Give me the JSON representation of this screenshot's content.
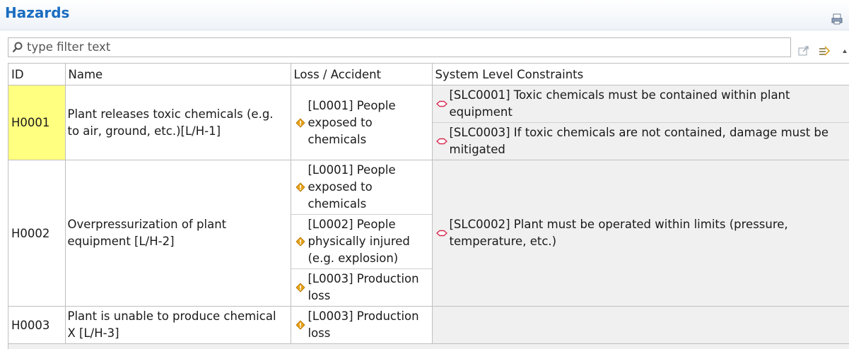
{
  "view": {
    "title": "Hazards"
  },
  "filter": {
    "placeholder": "type filter text"
  },
  "table": {
    "headers": {
      "id": "ID",
      "name": "Name",
      "loss": "Loss / Accident",
      "constraints": "System Level Constraints"
    },
    "rows": [
      {
        "id": "H0001",
        "name": "Plant releases toxic chemicals (e.g. to air, ground, etc.)[L/H-1]",
        "losses": [
          "[L0001] People exposed to chemicals"
        ],
        "constraints": [
          "[SLC0001] Toxic chemicals must be contained within plant equipment",
          "[SLC0003] If toxic chemicals are not contained, damage must be mitigated"
        ]
      },
      {
        "id": "H0002",
        "name": "Overpressurization of plant equipment [L/H-2]",
        "losses": [
          "[L0001] People exposed to chemicals",
          "[L0002] People physically injured (e.g. explosion)",
          "[L0003] Production loss"
        ],
        "constraints": [
          "[SLC0002] Plant must be operated within limits (pressure, temperature, etc.)"
        ]
      },
      {
        "id": "H0003",
        "name": "Plant is unable to produce chemical X [L/H-3]",
        "losses": [
          "[L0003] Production loss"
        ],
        "constraints": []
      }
    ]
  },
  "icons": {
    "loss": "warning-diamond-icon",
    "constraint": "constraint-link-icon",
    "print": "print-icon",
    "search": "magnifier-icon"
  },
  "colors": {
    "title": "#1a6cc0",
    "selected_cell": "#ffff80",
    "loss_icon": "#e8a317",
    "constraint_icon": "#d62b50"
  }
}
